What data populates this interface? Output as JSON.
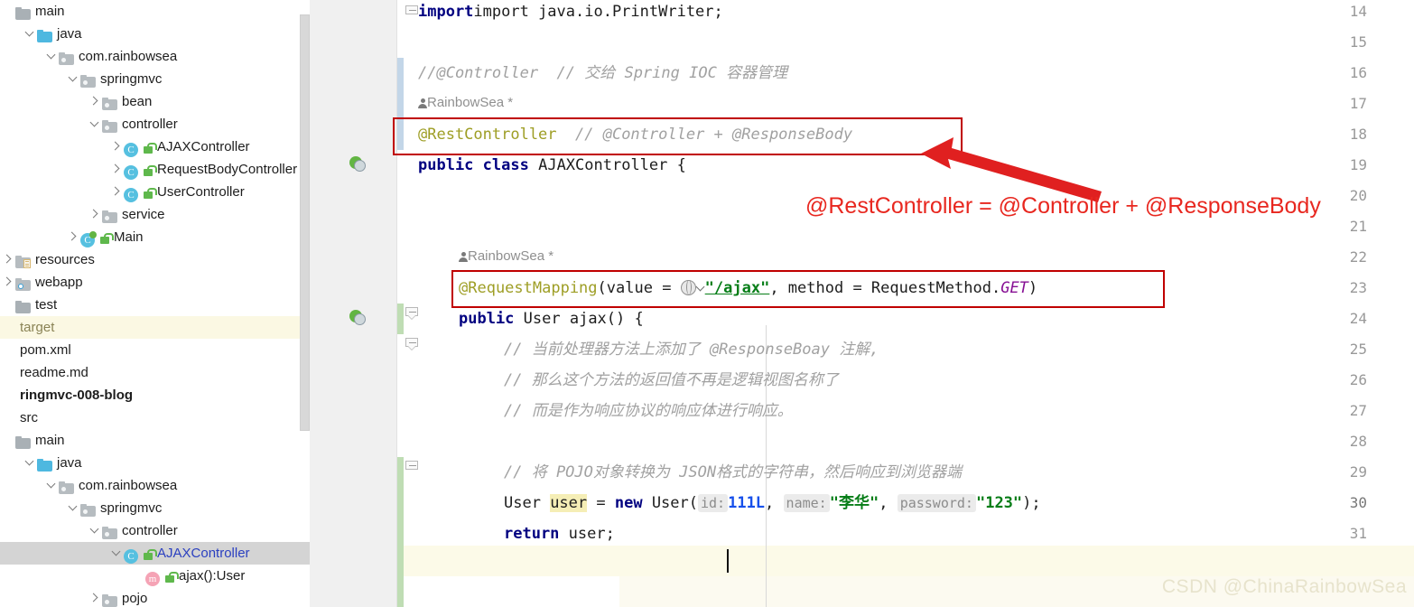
{
  "sidebar": {
    "scrollbar": "vertical-scrollbar",
    "items": [
      {
        "label": "main",
        "indent": 0,
        "arrow": "none",
        "icon": "folder-grey",
        "style": "plain",
        "row": 0
      },
      {
        "label": "java",
        "indent": 1,
        "arrow": "down",
        "icon": "folder-blue",
        "style": "plain",
        "row": 1
      },
      {
        "label": "com.rainbowsea",
        "indent": 2,
        "arrow": "down",
        "icon": "package",
        "style": "plain",
        "row": 2
      },
      {
        "label": "springmvc",
        "indent": 3,
        "arrow": "down",
        "icon": "package",
        "style": "plain",
        "row": 3
      },
      {
        "label": "bean",
        "indent": 4,
        "arrow": "right",
        "icon": "package",
        "style": "plain",
        "row": 4
      },
      {
        "label": "controller",
        "indent": 4,
        "arrow": "down",
        "icon": "package",
        "style": "plain",
        "row": 5
      },
      {
        "label": "AJAXController",
        "indent": 5,
        "arrow": "right",
        "icon": "class-lock",
        "style": "plain",
        "row": 6
      },
      {
        "label": "RequestBodyController",
        "indent": 5,
        "arrow": "right",
        "icon": "class-lock",
        "style": "plain",
        "row": 7
      },
      {
        "label": "UserController",
        "indent": 5,
        "arrow": "right",
        "icon": "class-lock",
        "style": "plain",
        "row": 8
      },
      {
        "label": "service",
        "indent": 4,
        "arrow": "right",
        "icon": "package",
        "style": "plain",
        "row": 9
      },
      {
        "label": "Main",
        "indent": 3,
        "arrow": "right",
        "icon": "class-run-lock",
        "style": "plain",
        "row": 10
      },
      {
        "label": "resources",
        "indent": 0,
        "arrow": "right",
        "icon": "resources",
        "style": "plain",
        "row": 11
      },
      {
        "label": "webapp",
        "indent": 0,
        "arrow": "right",
        "icon": "webapp",
        "style": "plain",
        "row": 12
      },
      {
        "label": "test",
        "indent": 0,
        "arrow": "none",
        "icon": "folder-grey",
        "style": "plain",
        "row": 13
      },
      {
        "label": "target",
        "indent": 0,
        "arrow": "none",
        "icon": "none",
        "style": "dim-highlight",
        "row": 14
      },
      {
        "label": "pom.xml",
        "indent": 0,
        "arrow": "none",
        "icon": "none",
        "style": "plain",
        "row": 15
      },
      {
        "label": "readme.md",
        "indent": 0,
        "arrow": "none",
        "icon": "none",
        "style": "plain",
        "row": 16
      },
      {
        "label": "ringmvc-008-blog",
        "indent": 0,
        "arrow": "none",
        "icon": "none",
        "style": "bold",
        "row": 17
      },
      {
        "label": "src",
        "indent": 0,
        "arrow": "none",
        "icon": "none",
        "style": "plain",
        "row": 18
      },
      {
        "label": "main",
        "indent": 0,
        "arrow": "none",
        "icon": "folder-grey",
        "style": "plain",
        "row": 19
      },
      {
        "label": "java",
        "indent": 1,
        "arrow": "down",
        "icon": "folder-blue",
        "style": "plain",
        "row": 20
      },
      {
        "label": "com.rainbowsea",
        "indent": 2,
        "arrow": "down",
        "icon": "package",
        "style": "plain",
        "row": 21
      },
      {
        "label": "springmvc",
        "indent": 3,
        "arrow": "down",
        "icon": "package",
        "style": "plain",
        "row": 22
      },
      {
        "label": "controller",
        "indent": 4,
        "arrow": "down",
        "icon": "package",
        "style": "plain",
        "row": 23
      },
      {
        "label": "AJAXController",
        "indent": 5,
        "arrow": "down",
        "icon": "class-lock",
        "style": "selected-blue",
        "row": 24
      },
      {
        "label": "ajax():User",
        "indent": 6,
        "arrow": "none",
        "icon": "method-lock",
        "style": "plain",
        "row": 25
      },
      {
        "label": "pojo",
        "indent": 4,
        "arrow": "right",
        "icon": "package",
        "style": "plain",
        "row": 26
      }
    ]
  },
  "editor": {
    "line_numbers": [
      "14",
      "15",
      "16",
      "17",
      "18",
      "19",
      "20",
      "21",
      "22",
      "23",
      "24",
      "25",
      "26",
      "27",
      "28",
      "29",
      "30",
      "31"
    ],
    "current_line": "30",
    "gutter_icons": [
      {
        "line": "18",
        "icon": "run-class-gutter-icon"
      },
      {
        "line": "22",
        "icon": "run-method-gutter-icon"
      }
    ],
    "lines": {
      "l14": {
        "text": "import java.io.PrintWriter;"
      },
      "l16": {
        "text": "//@Controller  // 交给 Spring IOC 容器管理"
      },
      "inlay16": {
        "text": "RainbowSea *"
      },
      "l17": {
        "annotation": "@RestController",
        "comment": "// @Controller + @ResponseBody"
      },
      "l18": {
        "text": "public class AJAXController {"
      },
      "inlay21": {
        "text": "RainbowSea *"
      },
      "l21": {
        "annotation": "@RequestMapping",
        "open": "(",
        "param1": "value = ",
        "url": "\"/ajax\"",
        "mid": ", method = RequestMethod.",
        "statik": "GET",
        "close": ")"
      },
      "l22": {
        "text": "public User ajax() {"
      },
      "l23": {
        "text": "// 当前处理器方法上添加了 @ResponseBoay 注解,"
      },
      "l24": {
        "text": "// 那么这个方法的返回值不再是逻辑视图名称了"
      },
      "l25": {
        "text": "// 而是作为响应协议的响应体进行响应。"
      },
      "l27": {
        "text": "// 将 POJO对象转换为 JSON格式的字符串，然后响应到浏览器端"
      },
      "l28": {
        "type": "User ",
        "ident": "user",
        "eq": " = ",
        "new": "new",
        "ctor": " User(",
        "hint_id": "id:",
        "num": "111L",
        "c1": ",",
        "hint_name": "name:",
        "name": "\"李华\"",
        "c2": ",",
        "hint_pw": "password:",
        "pw": "\"123\"",
        "tail": ");"
      },
      "l29": {
        "ret": "return",
        "val": " user;"
      }
    }
  },
  "annotation": {
    "callout_text": "@RestController = @Controller + @ResponseBody",
    "box_color": "#c00000",
    "text_color": "#e8271f",
    "arrow": "red-arrow-icon",
    "boxes": [
      "rest-controller-highlight-box",
      "request-mapping-highlight-box"
    ]
  },
  "watermark": {
    "text": "CSDN @ChinaRainbowSea"
  }
}
